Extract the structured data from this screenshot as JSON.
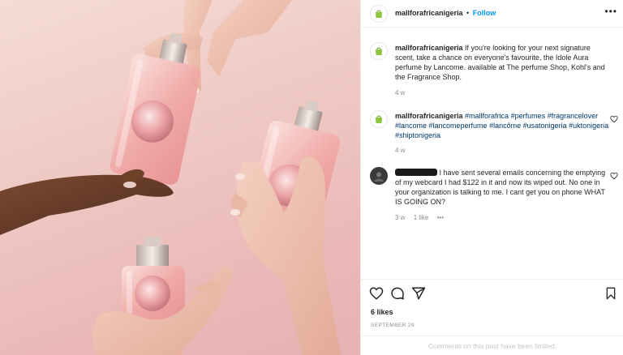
{
  "post": {
    "image_alt_subject": "perfume-bottles-hands",
    "account": "mallforafricanigeria",
    "separator": "•",
    "follow_label": "Follow",
    "more_icon": "more-horizontal-icon"
  },
  "comments": [
    {
      "user": "mallforafricanigeria",
      "text": "If you're looking for your next signature scent, take a chance on everyone's favourite, the Idole Aura perfume by Lancome. available at The perfume Shop, Kohl's and the Fragrance Shop.",
      "time": "4 w"
    },
    {
      "user": "mallforafricanigeria",
      "text": "#mallforafrica #perfumes #fragrancelover #lancome #lancomeperfume #lancôme #usatonigeria #uktonigeria #shiptonigeria",
      "time": "4 w"
    },
    {
      "user": "",
      "text": "I have sent several emails concerning the emptying of my webcard I had $122 in it and now its wiped out. No one in your organization is talking to me. I cant get you on phone WHAT IS GOING ON?",
      "time": "3 w",
      "likes": "1 like",
      "more": "•••"
    }
  ],
  "actions": {
    "like_icon": "heart-icon",
    "comment_icon": "comment-icon",
    "share_icon": "share-icon",
    "save_icon": "bookmark-icon"
  },
  "likes_count": "6 likes",
  "post_date": "SEPTEMBER 29",
  "comments_limited": "Comments on this post have been limited.",
  "colors": {
    "link_blue": "#0095f6",
    "hashtag_blue": "#00376b",
    "muted": "#8e8e8e",
    "logo_green": "#8cc63f"
  }
}
